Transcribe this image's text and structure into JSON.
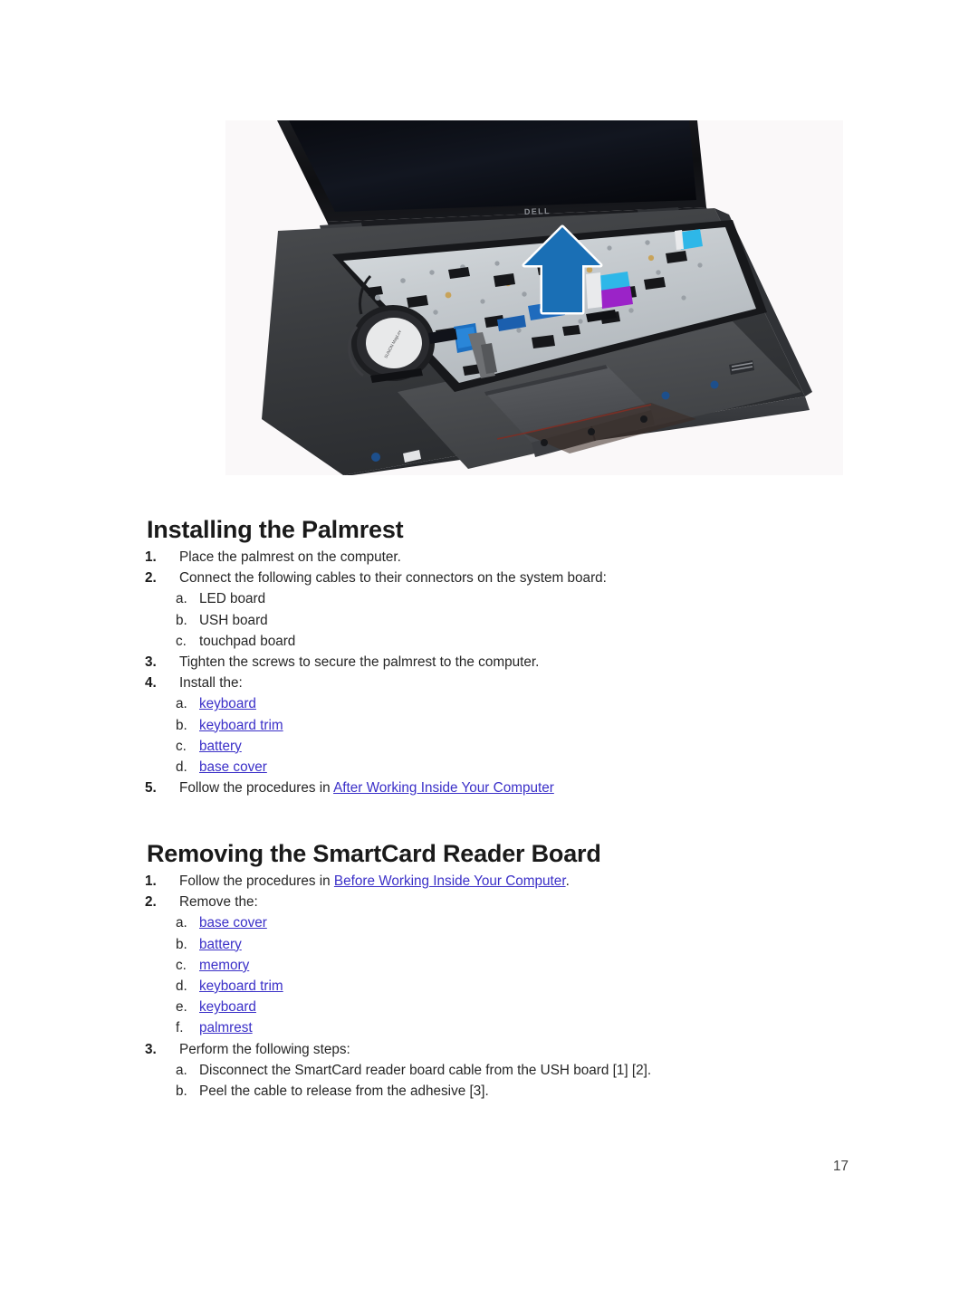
{
  "page": {
    "number": "17"
  },
  "figure": {
    "name": "dell-laptop-palmrest-removed-photo",
    "alt_label": "Dell laptop with palmrest removed, blue arrow indicating lift direction",
    "brand_logo_text": "DELL",
    "arrow_color": "#1a6fb5",
    "background_color": "#faf8f9",
    "cable_colors": [
      "#2eb7e8",
      "#9b23c8",
      "#1d6fc0"
    ]
  },
  "sections": [
    {
      "id": "installing-the-palmrest",
      "heading": "Installing the Palmrest",
      "steps": [
        {
          "marker": "1.",
          "level": 1,
          "text": "Place the palmrest on the computer."
        },
        {
          "marker": "2.",
          "level": 1,
          "text": "Connect the following cables to their connectors on the system board:"
        },
        {
          "marker": "a.",
          "level": 2,
          "text": "LED board"
        },
        {
          "marker": "b.",
          "level": 2,
          "text": "USH board"
        },
        {
          "marker": "c.",
          "level": 2,
          "text": "touchpad board"
        },
        {
          "marker": "3.",
          "level": 1,
          "text": "Tighten the screws to secure the palmrest to the computer."
        },
        {
          "marker": "4.",
          "level": 1,
          "text": "Install the:"
        },
        {
          "marker": "a.",
          "level": 2,
          "link": "keyboard"
        },
        {
          "marker": "b.",
          "level": 2,
          "link": "keyboard trim"
        },
        {
          "marker": "c.",
          "level": 2,
          "link": "battery"
        },
        {
          "marker": "d.",
          "level": 2,
          "link": "base cover"
        },
        {
          "marker": "5.",
          "level": 1,
          "before": "Follow the procedures in ",
          "link": "After Working Inside Your Computer",
          "after": ""
        }
      ]
    },
    {
      "id": "removing-the-smartcard-reader-board",
      "heading": "Removing the SmartCard Reader Board",
      "steps": [
        {
          "marker": "1.",
          "level": 1,
          "before": "Follow the procedures in ",
          "link": "Before Working Inside Your Computer",
          "after": "."
        },
        {
          "marker": "2.",
          "level": 1,
          "text": "Remove the:"
        },
        {
          "marker": "a.",
          "level": 2,
          "link": "base cover"
        },
        {
          "marker": "b.",
          "level": 2,
          "link": "battery"
        },
        {
          "marker": "c.",
          "level": 2,
          "link": "memory"
        },
        {
          "marker": "d.",
          "level": 2,
          "link": "keyboard trim"
        },
        {
          "marker": "e.",
          "level": 2,
          "link": "keyboard"
        },
        {
          "marker": "f.",
          "level": 2,
          "link": "palmrest"
        },
        {
          "marker": "3.",
          "level": 1,
          "text": "Perform the following steps:"
        },
        {
          "marker": "a.",
          "level": 2,
          "text": "Disconnect the SmartCard reader board cable from the USH board [1] [2]."
        },
        {
          "marker": "b.",
          "level": 2,
          "text": "Peel the cable to release from the adhesive [3]."
        }
      ]
    }
  ],
  "colors": {
    "link": "#3b30c8",
    "heading": "#1a1a1a",
    "body": "#262626"
  }
}
